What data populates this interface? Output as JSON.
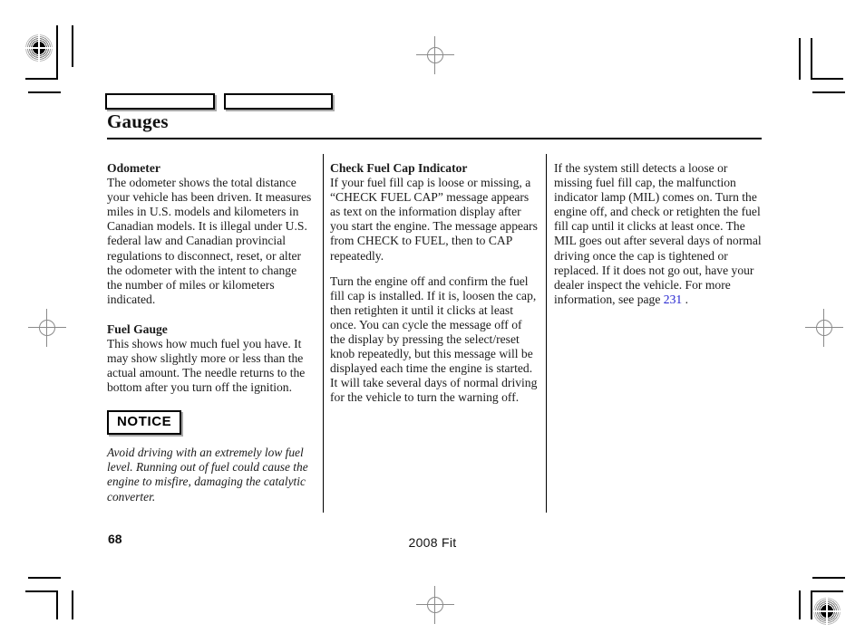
{
  "document": {
    "title": "Gauges",
    "page_number": "68",
    "model_footer": "2008  Fit",
    "link_color": "#2323d0"
  },
  "header": {
    "tabs": [
      {
        "label": ""
      },
      {
        "label": ""
      }
    ]
  },
  "columns": {
    "left": {
      "sections": [
        {
          "heading": "Odometer",
          "paragraphs": [
            "The odometer shows the total distance your vehicle has been driven. It measures miles in U.S. models and kilometers in Canadian models. It is illegal under U.S. federal law and Canadian provincial regulations to disconnect, reset, or alter the odometer with the intent to change the number of miles or kilometers indicated."
          ]
        },
        {
          "heading": "Fuel Gauge",
          "paragraphs": [
            "This shows how much fuel you have. It may show slightly more or less than the actual amount. The needle returns to the bottom after you turn off the ignition."
          ]
        }
      ],
      "notice": {
        "label": "NOTICE",
        "text": "Avoid driving with an extremely low fuel level. Running out of fuel could cause the engine to misfire, damaging the catalytic converter."
      }
    },
    "middle": {
      "heading": "Check Fuel Cap Indicator",
      "paragraphs": [
        "If your fuel fill cap is loose or missing, a “CHECK FUEL CAP” message appears as text on the information display after you start the engine. The message appears from CHECK to FUEL, then to CAP repeatedly.",
        "Turn the engine off and confirm the fuel fill cap is installed. If it is, loosen the cap, then retighten it until it clicks at least once. You can cycle the message off of the display by pressing the select/reset knob repeatedly, but this message will be displayed each time the engine is started. It will take several days of normal driving for the vehicle to turn the warning off."
      ]
    },
    "right": {
      "paragraph_before_link": "If the system still detects a loose or missing fuel fill cap, the malfunction indicator lamp (MIL) comes on. Turn the engine off, and check or retighten the fuel fill cap until it clicks at least once. The MIL goes out after several days of normal driving once the cap is tightened or replaced. If it does not go out, have your dealer inspect the vehicle. For more information, see page ",
      "page_link": "231",
      "paragraph_after_link": " ."
    }
  }
}
